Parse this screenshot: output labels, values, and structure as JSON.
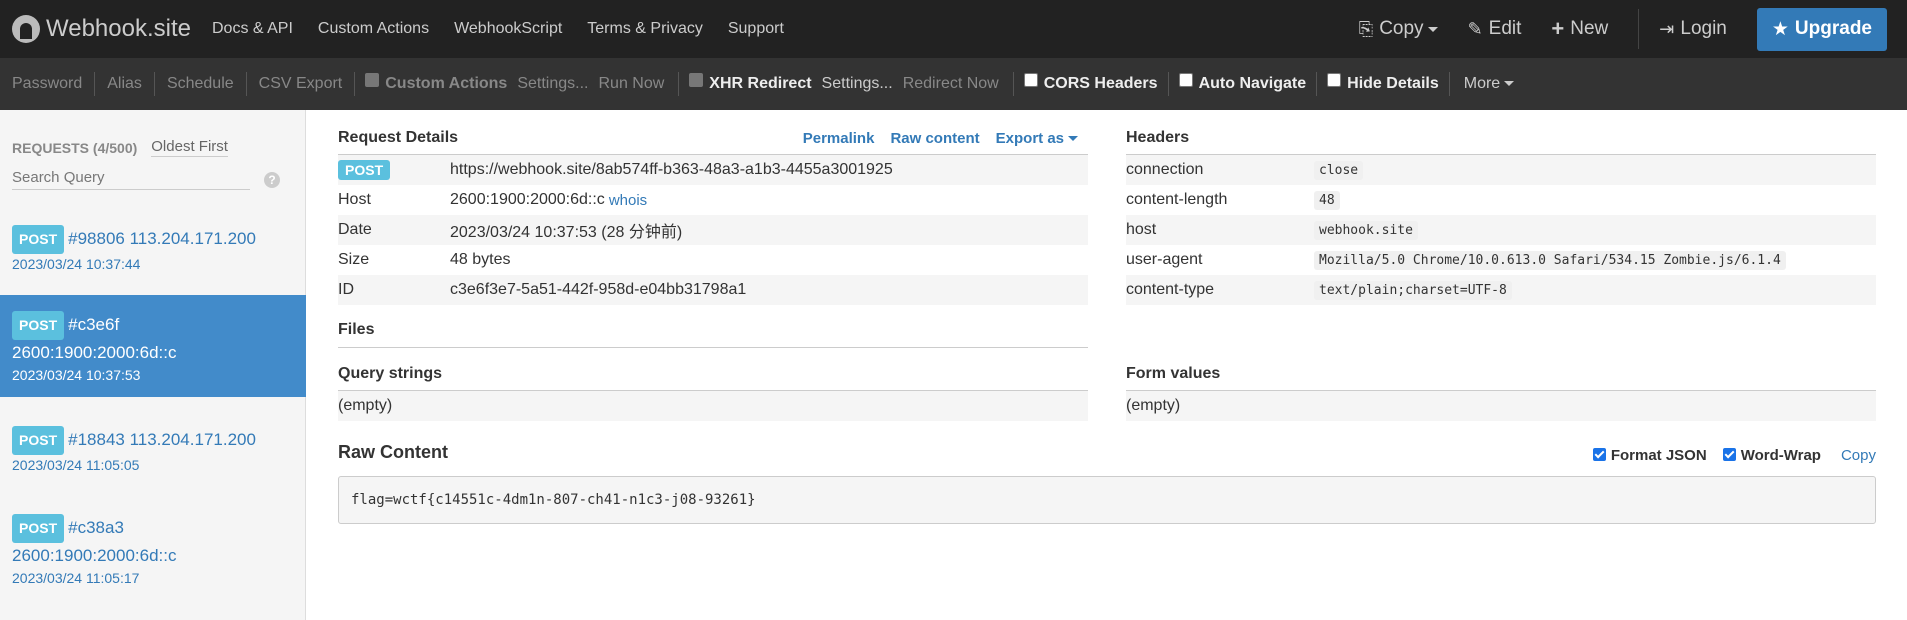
{
  "brand": {
    "name": "Webhook.site"
  },
  "nav": {
    "links": [
      "Docs & API",
      "Custom Actions",
      "WebhookScript",
      "Terms & Privacy",
      "Support"
    ],
    "copy": "Copy",
    "edit": "Edit",
    "new": "New",
    "login": "Login",
    "upgrade": "Upgrade"
  },
  "toolbar": {
    "password": "Password",
    "alias": "Alias",
    "schedule": "Schedule",
    "csv_export": "CSV Export",
    "custom_actions": "Custom Actions",
    "custom_settings": "Settings...",
    "run_now": "Run Now",
    "xhr_redirect": "XHR Redirect",
    "xhr_settings": "Settings...",
    "redirect_now": "Redirect Now",
    "cors_headers": "CORS Headers",
    "auto_navigate": "Auto Navigate",
    "hide_details": "Hide Details",
    "more": "More"
  },
  "sidebar": {
    "requests_label": "REQUESTS (4/500)",
    "sort_label": "Oldest First",
    "search_placeholder": "Search Query",
    "help": "?",
    "items": [
      {
        "method": "POST",
        "title": "#98806 113.204.171.200",
        "date": "2023/03/24 10:37:44"
      },
      {
        "method": "POST",
        "title_line1": "#c3e6f",
        "title_line2": "2600:1900:2000:6d::c",
        "date": "2023/03/24 10:37:53"
      },
      {
        "method": "POST",
        "title": "#18843 113.204.171.200",
        "date": "2023/03/24 11:05:05"
      },
      {
        "method": "POST",
        "title_line1": "#c38a3",
        "title_line2": "2600:1900:2000:6d::c",
        "date": "2023/03/24 11:05:17"
      }
    ]
  },
  "details": {
    "title": "Request Details",
    "permalink": "Permalink",
    "raw_content": "Raw content",
    "export_as": "Export as",
    "method": "POST",
    "url": "https://webhook.site/8ab574ff-b363-48a3-a1b3-4455a3001925",
    "host_label": "Host",
    "host_value": "2600:1900:2000:6d::c",
    "whois": "whois",
    "date_label": "Date",
    "date_value": "2023/03/24 10:37:53 (28 分钟前)",
    "size_label": "Size",
    "size_value": "48 bytes",
    "id_label": "ID",
    "id_value": "c3e6f3e7-5a51-442f-958d-e04bb31798a1",
    "files_title": "Files",
    "query_title": "Query strings",
    "query_value": "(empty)"
  },
  "headers": {
    "title": "Headers",
    "rows": [
      {
        "key": "connection",
        "value": "close"
      },
      {
        "key": "content-length",
        "value": "48"
      },
      {
        "key": "host",
        "value": "webhook.site"
      },
      {
        "key": "user-agent",
        "value": "Mozilla/5.0 Chrome/10.0.613.0 Safari/534.15 Zombie.js/6.1.4"
      },
      {
        "key": "content-type",
        "value": "text/plain;charset=UTF-8"
      }
    ],
    "form_title": "Form values",
    "form_value": "(empty)"
  },
  "raw": {
    "title": "Raw Content",
    "format_json": "Format JSON",
    "word_wrap": "Word-Wrap",
    "copy": "Copy",
    "content": "flag=wctf{c14551c-4dm1n-807-ch41-n1c3-j08-93261}"
  }
}
